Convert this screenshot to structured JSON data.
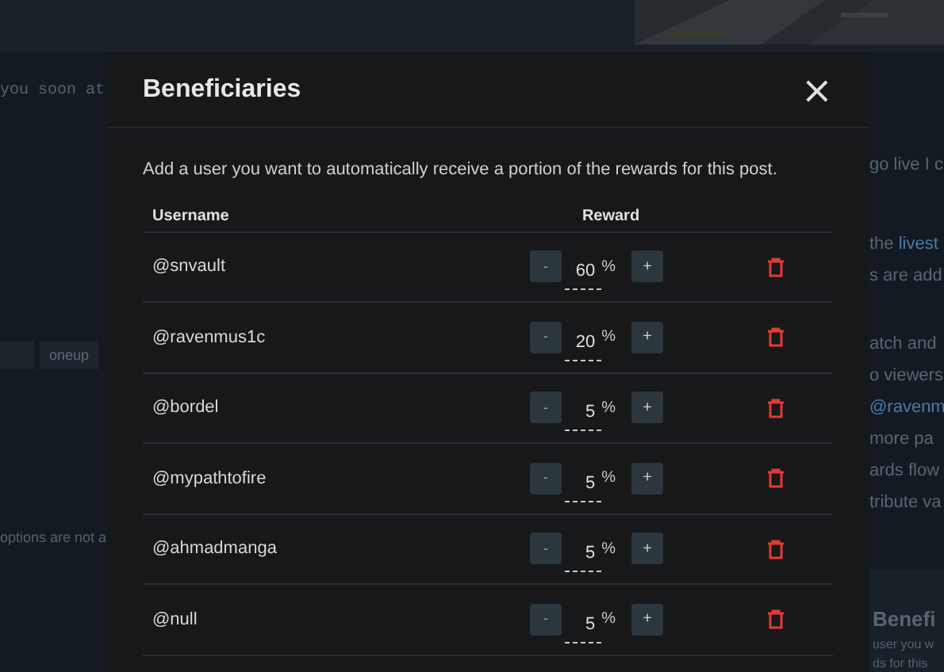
{
  "background": {
    "left_texts": [
      {
        "kind": "mono",
        "text": "you soon at"
      },
      {
        "kind": "tag",
        "text": "oneup"
      },
      {
        "kind": "plain",
        "text": "options are not a"
      }
    ],
    "right_texts": [
      {
        "kind": "plain",
        "text": "go live I c"
      },
      {
        "kind": "link_line",
        "before": "the ",
        "link": "livest"
      },
      {
        "kind": "plain",
        "text": "s are add"
      },
      {
        "kind": "plain",
        "text": "atch and"
      },
      {
        "kind": "plain",
        "text": "o viewers"
      },
      {
        "kind": "link",
        "text": "@ravenm"
      },
      {
        "kind": "plain",
        "text": "more pa"
      },
      {
        "kind": "plain",
        "text": "ards flow"
      },
      {
        "kind": "plain",
        "text": "tribute va"
      }
    ],
    "panel": {
      "title": "Benefi",
      "lines": [
        "user you w",
        "ds for this"
      ]
    }
  },
  "modal": {
    "title": "Beneficiaries",
    "close": "×",
    "description": "Add a user you want to automatically receive a portion of the rewards for this post.",
    "columns": [
      "Username",
      "Reward"
    ],
    "rows": [
      {
        "username": "@snvault",
        "minus": "-",
        "reward": "60",
        "unit": "%",
        "plus": "+"
      },
      {
        "username": "@ravenmus1c",
        "minus": "-",
        "reward": "20",
        "unit": "%",
        "plus": "+"
      },
      {
        "username": "@bordel",
        "minus": "-",
        "reward": "5",
        "unit": "%",
        "plus": "+"
      },
      {
        "username": "@mypathtofire",
        "minus": "-",
        "reward": "5",
        "unit": "%",
        "plus": "+"
      },
      {
        "username": "@ahmadmanga",
        "minus": "-",
        "reward": "5",
        "unit": "%",
        "plus": "+"
      },
      {
        "username": "@null",
        "minus": "-",
        "reward": "5",
        "unit": "%",
        "plus": "+"
      }
    ]
  }
}
